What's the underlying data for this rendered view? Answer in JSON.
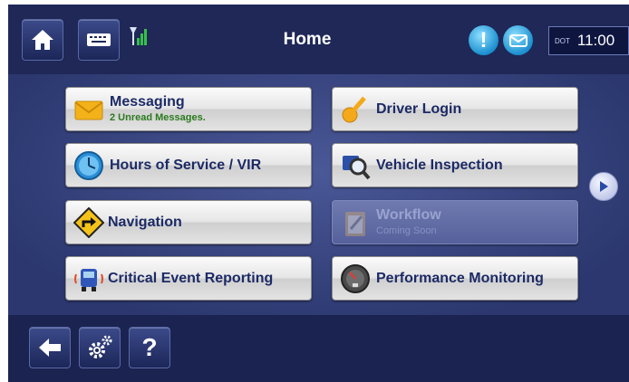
{
  "header": {
    "title": "Home",
    "dot_label": "DOT",
    "time": "11:00"
  },
  "tiles": [
    {
      "label": "Messaging",
      "sub": "2 Unread Messages.",
      "icon": "envelope-icon"
    },
    {
      "label": "Driver Login",
      "icon": "key-icon"
    },
    {
      "label": "Hours of Service / VIR",
      "icon": "clock-icon"
    },
    {
      "label": "Vehicle Inspection",
      "icon": "magnifier-truck-icon"
    },
    {
      "label": "Navigation",
      "icon": "turn-sign-icon"
    },
    {
      "label": "Workflow",
      "sub": "Coming Soon",
      "icon": "clipboard-icon",
      "disabled": true
    },
    {
      "label": "Critical Event Reporting",
      "icon": "truck-alert-icon"
    },
    {
      "label": "Performance Monitoring",
      "icon": "gauge-icon"
    }
  ],
  "bottom": {
    "help_label": "?"
  },
  "colors": {
    "background": "#283364",
    "tile_text": "#1c2a66",
    "unread_text": "#2a7a1e",
    "accent_blue": "#1b8fd0"
  }
}
